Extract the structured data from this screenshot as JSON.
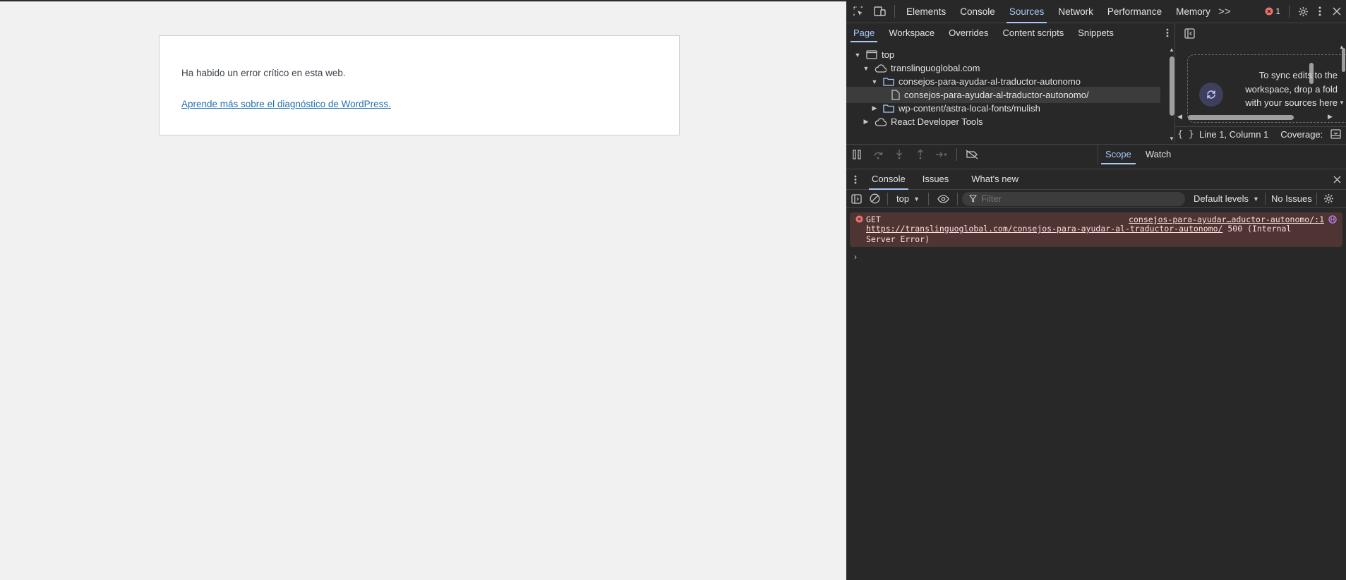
{
  "page": {
    "error_message": "Ha habido un error crítico en esta web.",
    "learn_more_link": "Aprende más sobre el diagnóstico de WordPress."
  },
  "devtools": {
    "main_tabs": [
      "Elements",
      "Console",
      "Sources",
      "Network",
      "Performance",
      "Memory"
    ],
    "active_main_tab": "Sources",
    "more_tabs_glyph": ">>",
    "error_count": "1",
    "navigator_tabs": [
      "Page",
      "Workspace",
      "Overrides",
      "Content scripts",
      "Snippets"
    ],
    "active_navigator_tab": "Page",
    "tree": [
      {
        "label": "top",
        "icon": "frame-icon",
        "expanded": true,
        "level": 0
      },
      {
        "label": "translinguoglobal.com",
        "icon": "cloud-icon",
        "expanded": true,
        "level": 1
      },
      {
        "label": "consejos-para-ayudar-al-traductor-autonomo",
        "icon": "folder-icon",
        "expanded": true,
        "level": 2
      },
      {
        "label": "consejos-para-ayudar-al-traductor-autonomo/",
        "icon": "file-icon",
        "expanded": null,
        "level": 3,
        "selected": true
      },
      {
        "label": "wp-content/astra-local-fonts/mulish",
        "icon": "folder-icon",
        "expanded": false,
        "level": 2
      },
      {
        "label": "React Developer Tools",
        "icon": "cloud-icon",
        "expanded": false,
        "level": 1
      }
    ],
    "sync_text": "To sync edits to the workspace, drop a fold with your sources here",
    "status": {
      "position": "Line 1, Column 1",
      "coverage": "Coverage:"
    },
    "scope_tabs": [
      "Scope",
      "Watch"
    ],
    "active_scope_tab": "Scope",
    "drawer_tabs": [
      "Console",
      "Issues",
      "What's new"
    ],
    "active_drawer_tab": "Console",
    "console_toolbar": {
      "context": "top",
      "filter_placeholder": "Filter",
      "levels": "Default levels",
      "issues": "No Issues"
    },
    "console_error": {
      "method": "GET",
      "source": "consejos-para-ayudar…aductor-autonomo/:1",
      "url": "https://translinguoglobal.com/consejos-para-ayudar-al-traductor-autonomo/",
      "status": " 500 (Internal",
      "status_cont": "Server Error)"
    },
    "prompt_glyph": "›"
  },
  "colors": {
    "accent": "#a8c7fa",
    "error_bg": "#4e3534",
    "error_icon": "#f2716c",
    "link": "#2271b1"
  }
}
